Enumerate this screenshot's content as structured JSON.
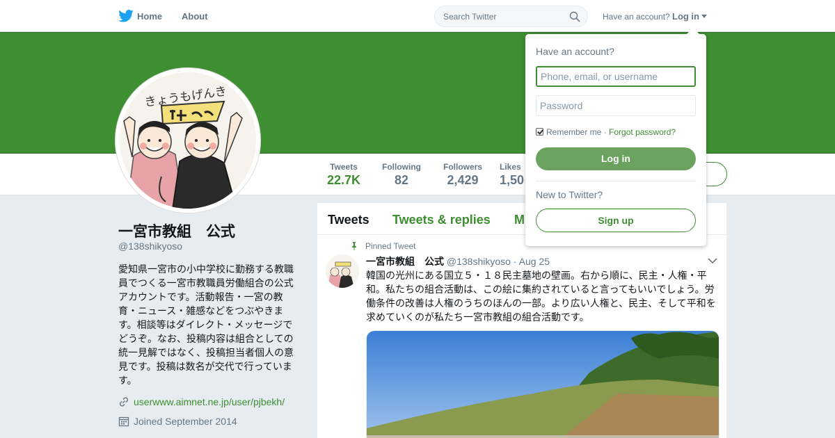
{
  "nav": {
    "home_label": "Home",
    "about_label": "About",
    "search_placeholder": "Search Twitter",
    "have_account": "Have an account?",
    "login_label": "Log in"
  },
  "colors": {
    "accent": "#3e8e32",
    "banner": "#3e8e32"
  },
  "profile": {
    "name": "一宮市教組　公式",
    "handle": "@138shikyoso",
    "bio": "愛知県一宮市の小中学校に勤務する教職員でつくる一宮市教職員労働組合の公式アカウントです。活動報告・一宮の教育・ニュース・雑感などをつぶやきます。相談等はダイレクト・メッセージでどうぞ。なお、投稿内容は組合としての統一見解ではなく、投稿担当者個人の意見です。投稿は数名が交代で行っています。",
    "link": "userwww.aimnet.ne.jp/user/pjbekh/",
    "joined": "Joined September 2014",
    "avatar_text": "きょうもげんき"
  },
  "stats": [
    {
      "label": "Tweets",
      "value": "22.7K",
      "active": true
    },
    {
      "label": "Following",
      "value": "82"
    },
    {
      "label": "Followers",
      "value": "2,429"
    },
    {
      "label": "Likes",
      "value": "1,50"
    }
  ],
  "timeline": {
    "tabs": [
      "Tweets",
      "Tweets & replies",
      "M"
    ],
    "active_tab": 0
  },
  "tweet": {
    "pinned_label": "Pinned Tweet",
    "name": "一宮市教組　公式",
    "handle": "@138shikyoso",
    "dot": "·",
    "date": "Aug 25",
    "text": "韓国の光州にある国立５・１８民主墓地の壁画。右から順に、民主・人権・平和。私たちの組合活動は、この絵に集約されていると言ってもいいでしょう。労働条件の改善は人権のうちのほんの一部。より広い人権と、民主、そして平和を求めていくのが私たち一宮市教組の組合活動です。"
  },
  "login_dropdown": {
    "title": "Have an account?",
    "username_placeholder": "Phone, email, or username",
    "password_placeholder": "Password",
    "remember_label": "Remember me",
    "separator": "·",
    "forgot_label": "Forgot password?",
    "login_button": "Log in",
    "new_label": "New to Twitter?",
    "signup_button": "Sign up"
  }
}
